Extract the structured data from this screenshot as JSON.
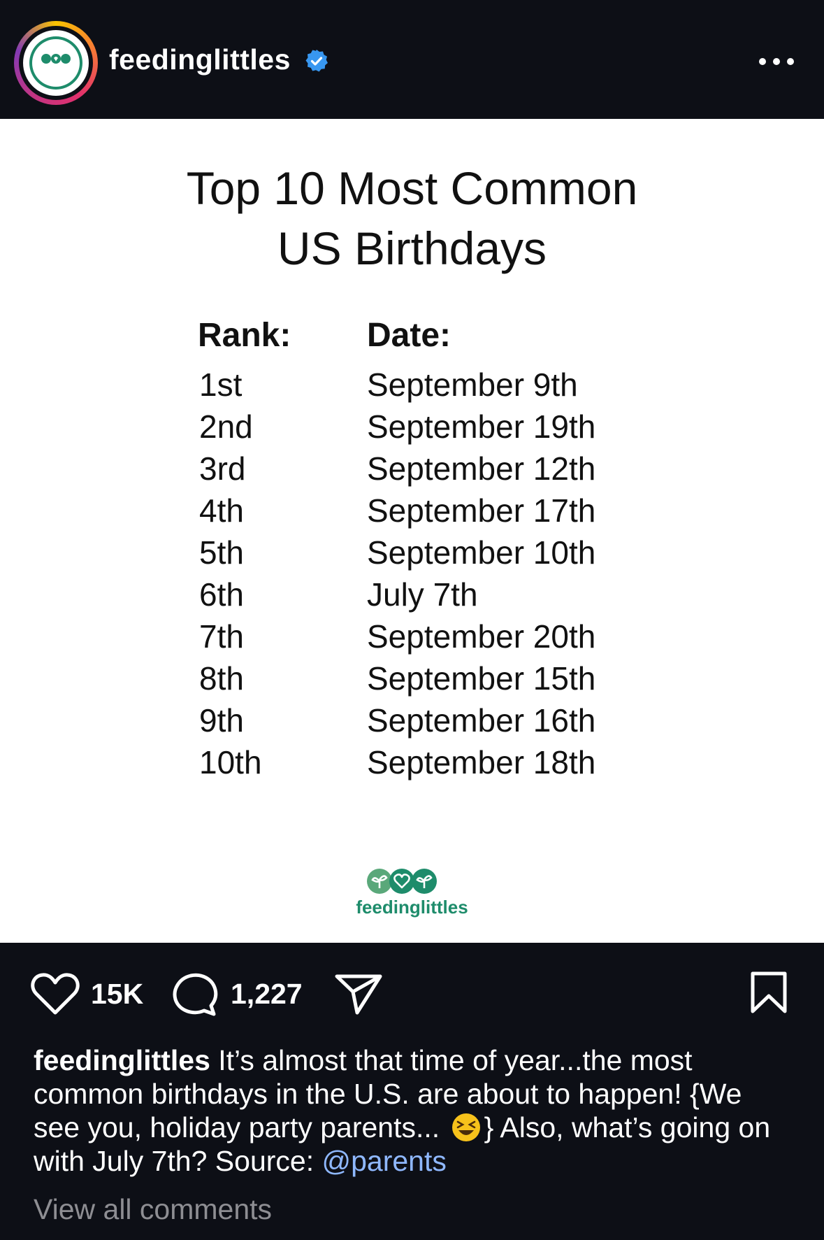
{
  "header": {
    "username": "feedinglittles",
    "avatar_text": "feedinglittles"
  },
  "post": {
    "title_line1": "Top 10 Most Common",
    "title_line2": "US Birthdays",
    "rank_header": "Rank:",
    "date_header": "Date:",
    "ranks": [
      "1st",
      "2nd",
      "3rd",
      "4th",
      "5th",
      "6th",
      "7th",
      "8th",
      "9th",
      "10th"
    ],
    "dates": [
      "September 9th",
      "September 19th",
      "September 12th",
      "September 17th",
      "September 10th",
      "July 7th",
      "September 20th",
      "September 15th",
      "September 16th",
      "September 18th"
    ],
    "brand": "feedinglittles"
  },
  "actions": {
    "likes": "15K",
    "comments": "1,227"
  },
  "caption": {
    "username": "feedinglittles",
    "text_before_emoji": " It’s almost that time of year...the most common birthdays in the U.S. are about to happen! {We see you, holiday party parents...",
    "text_after_emoji": "} Also, what’s going on with July 7th? Source: ",
    "mention": "@parents"
  },
  "view_comments": "View all comments",
  "colors": {
    "background": "#0d0f16",
    "brand_green": "#1e8c6b",
    "verified_blue": "#3897f0",
    "mention": "#8fb8ff",
    "muted": "#8e8e93"
  }
}
